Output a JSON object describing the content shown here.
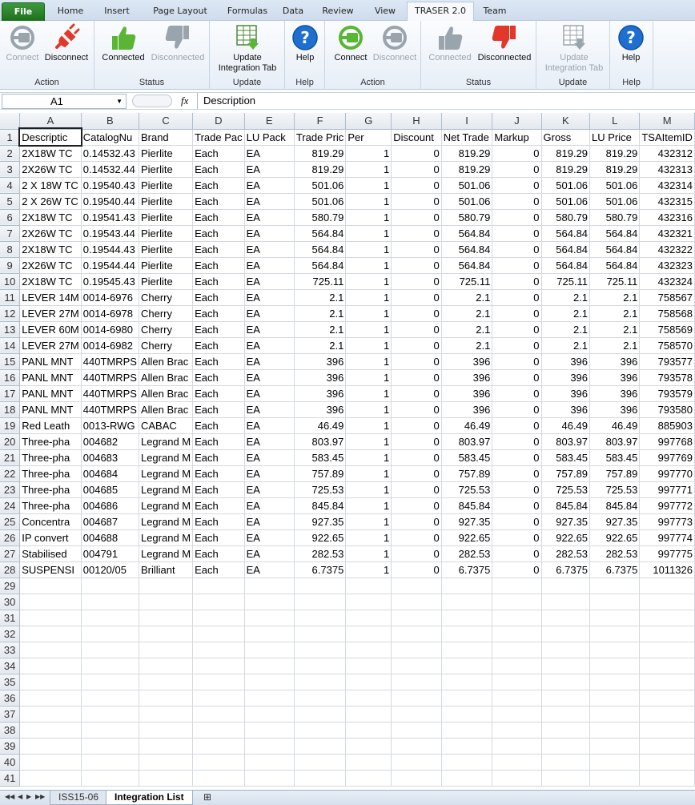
{
  "tabs": [
    "File",
    "Home",
    "Insert",
    "Page Layout",
    "Formulas",
    "Data",
    "Review",
    "View",
    "TRASER 2.0",
    "Team"
  ],
  "ribbon": {
    "groups": [
      {
        "label": "Action",
        "buttons": [
          {
            "label": "Connect",
            "icon": "plug-gray-icon",
            "enabled": false
          },
          {
            "label": "Disconnect",
            "icon": "plug-red-icon",
            "enabled": true
          }
        ]
      },
      {
        "label": "Status",
        "buttons": [
          {
            "label": "Connected",
            "icon": "thumbs-up-green-icon",
            "enabled": true
          },
          {
            "label": "Disconnected",
            "icon": "thumbs-down-gray-icon",
            "enabled": false
          }
        ]
      },
      {
        "label": "Update",
        "buttons": [
          {
            "label": "Update Integration Tab",
            "icon": "update-table-icon",
            "enabled": true
          }
        ]
      },
      {
        "label": "Help",
        "buttons": [
          {
            "label": "Help",
            "icon": "help-icon",
            "enabled": true
          }
        ]
      },
      {
        "label": "Action",
        "buttons": [
          {
            "label": "Connect",
            "icon": "plug-green-icon",
            "enabled": true
          },
          {
            "label": "Disconnect",
            "icon": "plug-gray-icon",
            "enabled": false
          }
        ]
      },
      {
        "label": "Status",
        "buttons": [
          {
            "label": "Connected",
            "icon": "thumbs-up-gray-icon",
            "enabled": false
          },
          {
            "label": "Disconnected",
            "icon": "thumbs-down-red-icon",
            "enabled": true
          }
        ]
      },
      {
        "label": "Update",
        "buttons": [
          {
            "label": "Update Integration Tab",
            "icon": "update-table-gray-icon",
            "enabled": false
          }
        ]
      },
      {
        "label": "Help",
        "buttons": [
          {
            "label": "Help",
            "icon": "help-icon",
            "enabled": true
          }
        ]
      }
    ]
  },
  "formula_bar": {
    "name_box": "A1",
    "fx": "fx",
    "value": "Description"
  },
  "columns": [
    "A",
    "B",
    "C",
    "D",
    "E",
    "F",
    "G",
    "H",
    "I",
    "J",
    "K",
    "L",
    "M"
  ],
  "header_row": [
    "Descriptic",
    "CatalogNu",
    "Brand",
    "Trade Pac",
    "LU Pack",
    "Trade Pric",
    "Per",
    "Discount",
    "Net Trade",
    "Markup",
    "Gross",
    "LU Price",
    "TSAItemID"
  ],
  "rows": [
    [
      "2X18W TC",
      "0.14532.43",
      "Pierlite",
      "Each",
      "EA",
      "819.29",
      "1",
      "0",
      "819.29",
      "0",
      "819.29",
      "819.29",
      "432312"
    ],
    [
      "2X26W TC",
      "0.14532.44",
      "Pierlite",
      "Each",
      "EA",
      "819.29",
      "1",
      "0",
      "819.29",
      "0",
      "819.29",
      "819.29",
      "432313"
    ],
    [
      "2 X 18W TC",
      "0.19540.43",
      "Pierlite",
      "Each",
      "EA",
      "501.06",
      "1",
      "0",
      "501.06",
      "0",
      "501.06",
      "501.06",
      "432314"
    ],
    [
      "2 X 26W TC",
      "0.19540.44",
      "Pierlite",
      "Each",
      "EA",
      "501.06",
      "1",
      "0",
      "501.06",
      "0",
      "501.06",
      "501.06",
      "432315"
    ],
    [
      "2X18W TC",
      "0.19541.43",
      "Pierlite",
      "Each",
      "EA",
      "580.79",
      "1",
      "0",
      "580.79",
      "0",
      "580.79",
      "580.79",
      "432316"
    ],
    [
      "2X26W TC",
      "0.19543.44",
      "Pierlite",
      "Each",
      "EA",
      "564.84",
      "1",
      "0",
      "564.84",
      "0",
      "564.84",
      "564.84",
      "432321"
    ],
    [
      "2X18W TC",
      "0.19544.43",
      "Pierlite",
      "Each",
      "EA",
      "564.84",
      "1",
      "0",
      "564.84",
      "0",
      "564.84",
      "564.84",
      "432322"
    ],
    [
      "2X26W TC",
      "0.19544.44",
      "Pierlite",
      "Each",
      "EA",
      "564.84",
      "1",
      "0",
      "564.84",
      "0",
      "564.84",
      "564.84",
      "432323"
    ],
    [
      "2X18W TC",
      "0.19545.43",
      "Pierlite",
      "Each",
      "EA",
      "725.11",
      "1",
      "0",
      "725.11",
      "0",
      "725.11",
      "725.11",
      "432324"
    ],
    [
      "LEVER 14M",
      "0014-6976",
      "Cherry",
      "Each",
      "EA",
      "2.1",
      "1",
      "0",
      "2.1",
      "0",
      "2.1",
      "2.1",
      "758567"
    ],
    [
      "LEVER 27M",
      "0014-6978",
      "Cherry",
      "Each",
      "EA",
      "2.1",
      "1",
      "0",
      "2.1",
      "0",
      "2.1",
      "2.1",
      "758568"
    ],
    [
      "LEVER 60M",
      "0014-6980",
      "Cherry",
      "Each",
      "EA",
      "2.1",
      "1",
      "0",
      "2.1",
      "0",
      "2.1",
      "2.1",
      "758569"
    ],
    [
      "LEVER 27M",
      "0014-6982",
      "Cherry",
      "Each",
      "EA",
      "2.1",
      "1",
      "0",
      "2.1",
      "0",
      "2.1",
      "2.1",
      "758570"
    ],
    [
      "PANL MNT",
      "440TMRPS",
      "Allen Brac",
      "Each",
      "EA",
      "396",
      "1",
      "0",
      "396",
      "0",
      "396",
      "396",
      "793577"
    ],
    [
      "PANL MNT",
      "440TMRPS",
      "Allen Brac",
      "Each",
      "EA",
      "396",
      "1",
      "0",
      "396",
      "0",
      "396",
      "396",
      "793578"
    ],
    [
      "PANL MNT",
      "440TMRPS",
      "Allen Brac",
      "Each",
      "EA",
      "396",
      "1",
      "0",
      "396",
      "0",
      "396",
      "396",
      "793579"
    ],
    [
      "PANL MNT",
      "440TMRPS",
      "Allen Brac",
      "Each",
      "EA",
      "396",
      "1",
      "0",
      "396",
      "0",
      "396",
      "396",
      "793580"
    ],
    [
      "Red Leath",
      "0013-RWG",
      "CABAC",
      "Each",
      "EA",
      "46.49",
      "1",
      "0",
      "46.49",
      "0",
      "46.49",
      "46.49",
      "885903"
    ],
    [
      "Three-pha",
      "004682",
      "Legrand M",
      "Each",
      "EA",
      "803.97",
      "1",
      "0",
      "803.97",
      "0",
      "803.97",
      "803.97",
      "997768"
    ],
    [
      "Three-pha",
      "004683",
      "Legrand M",
      "Each",
      "EA",
      "583.45",
      "1",
      "0",
      "583.45",
      "0",
      "583.45",
      "583.45",
      "997769"
    ],
    [
      "Three-pha",
      "004684",
      "Legrand M",
      "Each",
      "EA",
      "757.89",
      "1",
      "0",
      "757.89",
      "0",
      "757.89",
      "757.89",
      "997770"
    ],
    [
      "Three-pha",
      "004685",
      "Legrand M",
      "Each",
      "EA",
      "725.53",
      "1",
      "0",
      "725.53",
      "0",
      "725.53",
      "725.53",
      "997771"
    ],
    [
      "Three-pha",
      "004686",
      "Legrand M",
      "Each",
      "EA",
      "845.84",
      "1",
      "0",
      "845.84",
      "0",
      "845.84",
      "845.84",
      "997772"
    ],
    [
      "Concentra",
      "004687",
      "Legrand M",
      "Each",
      "EA",
      "927.35",
      "1",
      "0",
      "927.35",
      "0",
      "927.35",
      "927.35",
      "997773"
    ],
    [
      "IP convert",
      "004688",
      "Legrand M",
      "Each",
      "EA",
      "922.65",
      "1",
      "0",
      "922.65",
      "0",
      "922.65",
      "922.65",
      "997774"
    ],
    [
      "Stabilised",
      "004791",
      "Legrand M",
      "Each",
      "EA",
      "282.53",
      "1",
      "0",
      "282.53",
      "0",
      "282.53",
      "282.53",
      "997775"
    ],
    [
      "SUSPENSI",
      "00120/05",
      "Brilliant",
      "Each",
      "EA",
      "6.7375",
      "1",
      "0",
      "6.7375",
      "0",
      "6.7375",
      "6.7375",
      "1011326"
    ]
  ],
  "row_count_total": 41,
  "sheet_tabs": [
    "ISS15-06",
    "Integration List"
  ],
  "active_sheet": "Integration List"
}
